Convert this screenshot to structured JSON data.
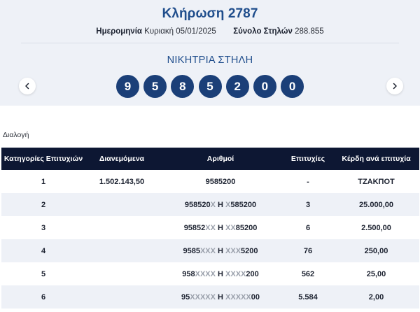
{
  "draw": {
    "title": "Κλήρωση 2787",
    "date_label": "Ημερομηνία",
    "date_value": "Κυριακή 05/01/2025",
    "total_label": "Σύνολο Στηλών",
    "total_value": "288.855"
  },
  "winning": {
    "title": "ΝΙΚΗΤΡΙΑ ΣΤΗΛΗ",
    "digits": [
      "9",
      "5",
      "8",
      "5",
      "2",
      "0",
      "0"
    ]
  },
  "filter_label": "Διαλογή",
  "table": {
    "headers": [
      "Κατηγορίες Επιτυχιών",
      "Διανεμόμενα",
      "Αριθμοί",
      "Επιτυχίες",
      "Κέρδη ανά επιτυχία"
    ],
    "rows": [
      {
        "cat": "1",
        "dist": "1.502.143,50",
        "nums": [
          {
            "t": "9585200",
            "x": false
          }
        ],
        "succ": "-",
        "prize": "ΤΖΑΚΠΟΤ"
      },
      {
        "cat": "2",
        "dist": "",
        "nums": [
          {
            "t": "958520",
            "x": false
          },
          {
            "t": "X",
            "x": true
          },
          {
            "t": " Η ",
            "x": false
          },
          {
            "t": "X",
            "x": true
          },
          {
            "t": "585200",
            "x": false
          }
        ],
        "succ": "3",
        "prize": "25.000,00"
      },
      {
        "cat": "3",
        "dist": "",
        "nums": [
          {
            "t": "95852",
            "x": false
          },
          {
            "t": "XX",
            "x": true
          },
          {
            "t": " Η ",
            "x": false
          },
          {
            "t": "XX",
            "x": true
          },
          {
            "t": "85200",
            "x": false
          }
        ],
        "succ": "6",
        "prize": "2.500,00"
      },
      {
        "cat": "4",
        "dist": "",
        "nums": [
          {
            "t": "9585",
            "x": false
          },
          {
            "t": "XXX",
            "x": true
          },
          {
            "t": " Η ",
            "x": false
          },
          {
            "t": "XXX",
            "x": true
          },
          {
            "t": "5200",
            "x": false
          }
        ],
        "succ": "76",
        "prize": "250,00"
      },
      {
        "cat": "5",
        "dist": "",
        "nums": [
          {
            "t": "958",
            "x": false
          },
          {
            "t": "XXXX",
            "x": true
          },
          {
            "t": " Η ",
            "x": false
          },
          {
            "t": "XXXX",
            "x": true
          },
          {
            "t": "200",
            "x": false
          }
        ],
        "succ": "562",
        "prize": "25,00"
      },
      {
        "cat": "6",
        "dist": "",
        "nums": [
          {
            "t": "95",
            "x": false
          },
          {
            "t": "XXXXX",
            "x": true
          },
          {
            "t": " Η ",
            "x": false
          },
          {
            "t": "XXXXX",
            "x": true
          },
          {
            "t": "00",
            "x": false
          }
        ],
        "succ": "5.584",
        "prize": "2,00"
      }
    ]
  },
  "colors": {
    "accent": "#1f4d8c",
    "ball": "#1b3f78",
    "table_header": "#0d1733",
    "panel_bg": "#eef1f7",
    "masked_digit": "#9aa0ab"
  },
  "icons": {
    "prev": "chevron-left-icon",
    "next": "chevron-right-icon"
  }
}
